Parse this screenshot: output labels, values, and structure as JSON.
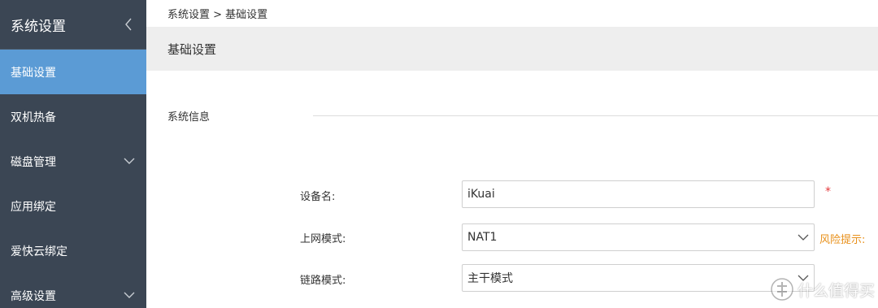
{
  "sidebar": {
    "title": "系统设置",
    "items": [
      {
        "label": "基础设置",
        "active": true,
        "expandable": false
      },
      {
        "label": "双机热备",
        "active": false,
        "expandable": false
      },
      {
        "label": "磁盘管理",
        "active": false,
        "expandable": true
      },
      {
        "label": "应用绑定",
        "active": false,
        "expandable": false
      },
      {
        "label": "爱快云绑定",
        "active": false,
        "expandable": false
      },
      {
        "label": "高级设置",
        "active": false,
        "expandable": true
      }
    ]
  },
  "breadcrumb": "系统设置 > 基础设置",
  "section_title": "基础设置",
  "group_title": "系统信息",
  "form": {
    "device_name": {
      "label": "设备名:",
      "value": "iKuai",
      "required_mark": "*"
    },
    "network_mode": {
      "label": "上网模式:",
      "value": "NAT1",
      "hint": "风险提示:"
    },
    "link_mode": {
      "label": "链路模式:",
      "value": "主干模式"
    }
  },
  "watermark": {
    "text": "什么值得买",
    "logo": "值"
  },
  "colors": {
    "sidebar_bg": "#3b4654",
    "active_bg": "#5b9bd5",
    "risk_hint": "#e8901a",
    "required": "#e4393c"
  }
}
